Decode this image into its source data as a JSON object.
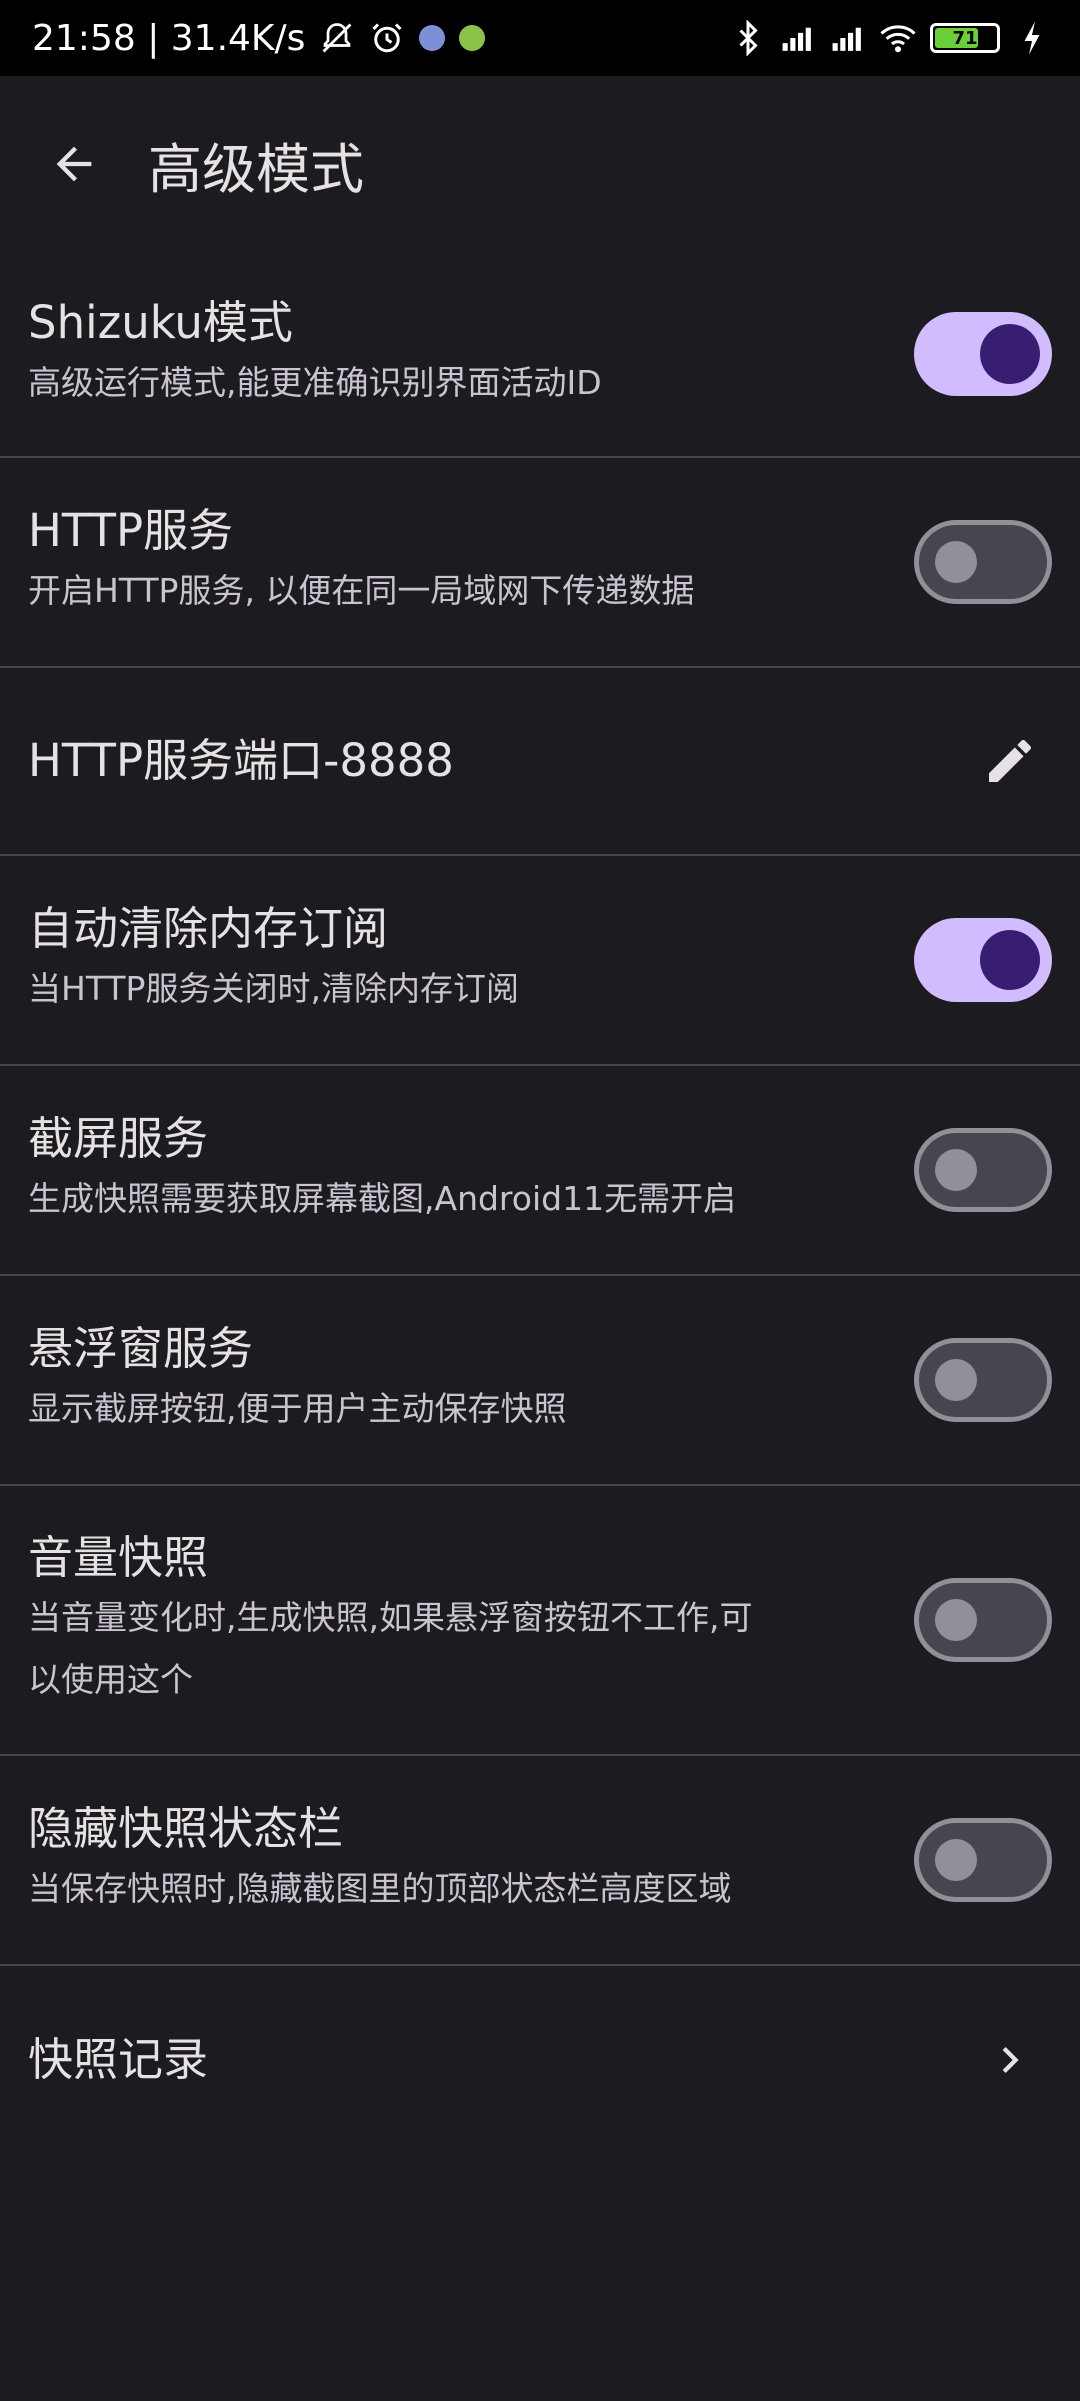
{
  "status_bar": {
    "time_speed": "21:58 | 31.4K/s",
    "battery_level": "71",
    "battery_color": "#6bcf3a"
  },
  "app_bar": {
    "back_icon": "arrow-back-icon",
    "title": "高级模式"
  },
  "settings": [
    {
      "title": "Shizuku模式",
      "subtitle": "高级运行模式,能更准确识别界面活动ID",
      "control": "switch",
      "checked": true
    },
    {
      "title": "HTTP服务",
      "subtitle": "开启HTTP服务, 以便在同一局域网下传递数据",
      "control": "switch",
      "checked": false
    },
    {
      "title": "HTTP服务端口-8888",
      "control": "edit-icon"
    },
    {
      "title": "自动清除内存订阅",
      "subtitle": "当HTTP服务关闭时,清除内存订阅",
      "control": "switch",
      "checked": true
    },
    {
      "title": "截屏服务",
      "subtitle": "生成快照需要获取屏幕截图,Android11无需开启",
      "control": "switch",
      "checked": false
    },
    {
      "title": "悬浮窗服务",
      "subtitle": "显示截屏按钮,便于用户主动保存快照",
      "control": "switch",
      "checked": false
    },
    {
      "title": "音量快照",
      "subtitle_line1": "当音量变化时,生成快照,如果悬浮窗按钮不工作,可",
      "subtitle_line2": "以使用这个",
      "control": "switch",
      "checked": false
    },
    {
      "title": "隐藏快照状态栏",
      "subtitle": "当保存快照时,隐藏截图里的顶部状态栏高度区域",
      "control": "switch",
      "checked": false
    },
    {
      "title": "快照记录",
      "control": "chevron-right-icon"
    }
  ],
  "colors": {
    "background": "#1c1b1f",
    "switch_on_track": "#d0bcff",
    "switch_on_thumb": "#381e72",
    "switch_off_track": "#49454f",
    "switch_off_outline": "#938f99"
  }
}
